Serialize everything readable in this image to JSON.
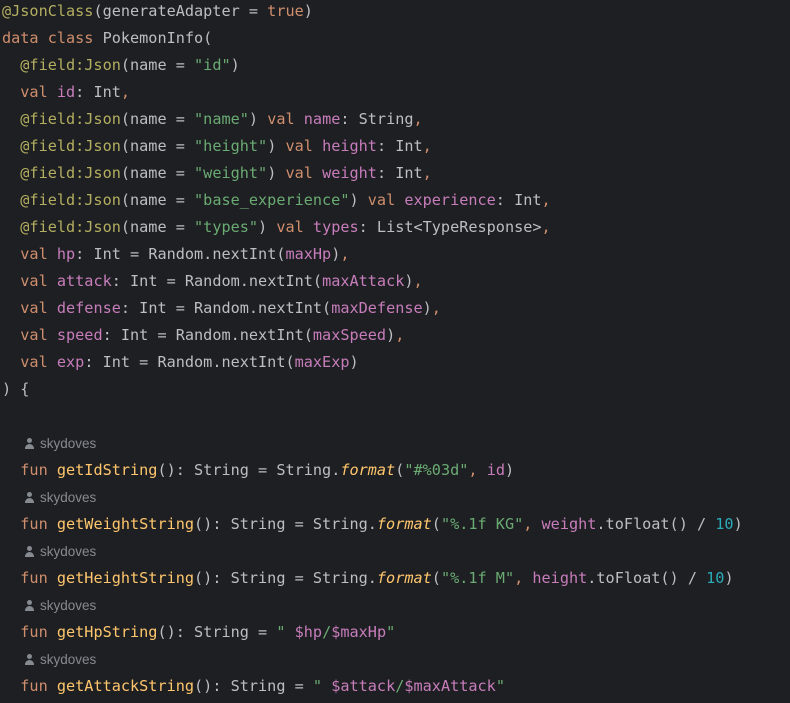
{
  "editor": {
    "language": "kotlin",
    "colors": {
      "background": "#1e1f22",
      "text": "#bcbec4",
      "keyword": "#cf8e6d",
      "annotation": "#b3ae60",
      "property": "#c77dbb",
      "string": "#6aab73",
      "number": "#2aacb8",
      "function_declaration": "#ffc66d",
      "hint": "#868a91"
    },
    "lines": [
      {
        "type": "code",
        "tokens": [
          {
            "t": "@JsonClass",
            "c": "ann"
          },
          {
            "t": "(generateAdapter = ",
            "c": "plain"
          },
          {
            "t": "true",
            "c": "kw"
          },
          {
            "t": ")",
            "c": "plain"
          }
        ]
      },
      {
        "type": "code",
        "tokens": [
          {
            "t": "data class ",
            "c": "kw"
          },
          {
            "t": "PokemonInfo(",
            "c": "plain"
          }
        ]
      },
      {
        "type": "code",
        "tokens": [
          {
            "t": "  @field:Json",
            "c": "ann"
          },
          {
            "t": "(name = ",
            "c": "plain"
          },
          {
            "t": "\"id\"",
            "c": "str"
          },
          {
            "t": ")",
            "c": "plain"
          }
        ]
      },
      {
        "type": "code",
        "tokens": [
          {
            "t": "  val ",
            "c": "kw"
          },
          {
            "t": "id",
            "c": "prop"
          },
          {
            "t": ": Int",
            "c": "plain"
          },
          {
            "t": ",",
            "c": "kw"
          }
        ]
      },
      {
        "type": "code",
        "tokens": [
          {
            "t": "  @field:Json",
            "c": "ann"
          },
          {
            "t": "(name = ",
            "c": "plain"
          },
          {
            "t": "\"name\"",
            "c": "str"
          },
          {
            "t": ") ",
            "c": "plain"
          },
          {
            "t": "val ",
            "c": "kw"
          },
          {
            "t": "name",
            "c": "prop"
          },
          {
            "t": ": String",
            "c": "plain"
          },
          {
            "t": ",",
            "c": "kw"
          }
        ]
      },
      {
        "type": "code",
        "tokens": [
          {
            "t": "  @field:Json",
            "c": "ann"
          },
          {
            "t": "(name = ",
            "c": "plain"
          },
          {
            "t": "\"height\"",
            "c": "str"
          },
          {
            "t": ") ",
            "c": "plain"
          },
          {
            "t": "val ",
            "c": "kw"
          },
          {
            "t": "height",
            "c": "prop"
          },
          {
            "t": ": Int",
            "c": "plain"
          },
          {
            "t": ",",
            "c": "kw"
          }
        ]
      },
      {
        "type": "code",
        "tokens": [
          {
            "t": "  @field:Json",
            "c": "ann"
          },
          {
            "t": "(name = ",
            "c": "plain"
          },
          {
            "t": "\"weight\"",
            "c": "str"
          },
          {
            "t": ") ",
            "c": "plain"
          },
          {
            "t": "val ",
            "c": "kw"
          },
          {
            "t": "weight",
            "c": "prop"
          },
          {
            "t": ": Int",
            "c": "plain"
          },
          {
            "t": ",",
            "c": "kw"
          }
        ]
      },
      {
        "type": "code",
        "tokens": [
          {
            "t": "  @field:Json",
            "c": "ann"
          },
          {
            "t": "(name = ",
            "c": "plain"
          },
          {
            "t": "\"base_experience\"",
            "c": "str"
          },
          {
            "t": ") ",
            "c": "plain"
          },
          {
            "t": "val ",
            "c": "kw"
          },
          {
            "t": "experience",
            "c": "prop"
          },
          {
            "t": ": Int",
            "c": "plain"
          },
          {
            "t": ",",
            "c": "kw"
          }
        ]
      },
      {
        "type": "code",
        "tokens": [
          {
            "t": "  @field:Json",
            "c": "ann"
          },
          {
            "t": "(name = ",
            "c": "plain"
          },
          {
            "t": "\"types\"",
            "c": "str"
          },
          {
            "t": ") ",
            "c": "plain"
          },
          {
            "t": "val ",
            "c": "kw"
          },
          {
            "t": "types",
            "c": "prop"
          },
          {
            "t": ": List<TypeResponse>",
            "c": "plain"
          },
          {
            "t": ",",
            "c": "kw"
          }
        ]
      },
      {
        "type": "code",
        "tokens": [
          {
            "t": "  val ",
            "c": "kw"
          },
          {
            "t": "hp",
            "c": "prop"
          },
          {
            "t": ": Int = Random.nextInt(",
            "c": "plain"
          },
          {
            "t": "maxHp",
            "c": "prop"
          },
          {
            "t": ")",
            "c": "plain"
          },
          {
            "t": ",",
            "c": "kw"
          }
        ]
      },
      {
        "type": "code",
        "tokens": [
          {
            "t": "  val ",
            "c": "kw"
          },
          {
            "t": "attack",
            "c": "prop"
          },
          {
            "t": ": Int = Random.nextInt(",
            "c": "plain"
          },
          {
            "t": "maxAttack",
            "c": "prop"
          },
          {
            "t": ")",
            "c": "plain"
          },
          {
            "t": ",",
            "c": "kw"
          }
        ]
      },
      {
        "type": "code",
        "tokens": [
          {
            "t": "  val ",
            "c": "kw"
          },
          {
            "t": "defense",
            "c": "prop"
          },
          {
            "t": ": Int = Random.nextInt(",
            "c": "plain"
          },
          {
            "t": "maxDefense",
            "c": "prop"
          },
          {
            "t": ")",
            "c": "plain"
          },
          {
            "t": ",",
            "c": "kw"
          }
        ]
      },
      {
        "type": "code",
        "tokens": [
          {
            "t": "  val ",
            "c": "kw"
          },
          {
            "t": "speed",
            "c": "prop"
          },
          {
            "t": ": Int = Random.nextInt(",
            "c": "plain"
          },
          {
            "t": "maxSpeed",
            "c": "prop"
          },
          {
            "t": ")",
            "c": "plain"
          },
          {
            "t": ",",
            "c": "kw"
          }
        ]
      },
      {
        "type": "code",
        "tokens": [
          {
            "t": "  val ",
            "c": "kw"
          },
          {
            "t": "exp",
            "c": "prop"
          },
          {
            "t": ": Int = Random.nextInt(",
            "c": "plain"
          },
          {
            "t": "maxExp",
            "c": "prop"
          },
          {
            "t": ")",
            "c": "plain"
          }
        ]
      },
      {
        "type": "code",
        "tokens": [
          {
            "t": ") {",
            "c": "plain"
          }
        ]
      },
      {
        "type": "blank",
        "tokens": []
      },
      {
        "type": "hint",
        "author": "skydoves"
      },
      {
        "type": "code",
        "tokens": [
          {
            "t": "  fun ",
            "c": "kw"
          },
          {
            "t": "getIdString",
            "c": "fndecl"
          },
          {
            "t": "(): String = String.",
            "c": "plain"
          },
          {
            "t": "format",
            "c": "static"
          },
          {
            "t": "(",
            "c": "plain"
          },
          {
            "t": "\"#%03d\"",
            "c": "str"
          },
          {
            "t": ", ",
            "c": "kw"
          },
          {
            "t": "id",
            "c": "prop"
          },
          {
            "t": ")",
            "c": "plain"
          }
        ]
      },
      {
        "type": "hint",
        "author": "skydoves"
      },
      {
        "type": "code",
        "tokens": [
          {
            "t": "  fun ",
            "c": "kw"
          },
          {
            "t": "getWeightString",
            "c": "fndecl"
          },
          {
            "t": "(): String = String.",
            "c": "plain"
          },
          {
            "t": "format",
            "c": "static"
          },
          {
            "t": "(",
            "c": "plain"
          },
          {
            "t": "\"%.1f KG\"",
            "c": "str"
          },
          {
            "t": ", ",
            "c": "kw"
          },
          {
            "t": "weight",
            "c": "prop"
          },
          {
            "t": ".toFloat() / ",
            "c": "plain"
          },
          {
            "t": "10",
            "c": "num"
          },
          {
            "t": ")",
            "c": "plain"
          }
        ]
      },
      {
        "type": "hint",
        "author": "skydoves"
      },
      {
        "type": "code",
        "tokens": [
          {
            "t": "  fun ",
            "c": "kw"
          },
          {
            "t": "getHeightString",
            "c": "fndecl"
          },
          {
            "t": "(): String = String.",
            "c": "plain"
          },
          {
            "t": "format",
            "c": "static"
          },
          {
            "t": "(",
            "c": "plain"
          },
          {
            "t": "\"%.1f M\"",
            "c": "str"
          },
          {
            "t": ", ",
            "c": "kw"
          },
          {
            "t": "height",
            "c": "prop"
          },
          {
            "t": ".toFloat() / ",
            "c": "plain"
          },
          {
            "t": "10",
            "c": "num"
          },
          {
            "t": ")",
            "c": "plain"
          }
        ]
      },
      {
        "type": "hint",
        "author": "skydoves"
      },
      {
        "type": "code",
        "tokens": [
          {
            "t": "  fun ",
            "c": "kw"
          },
          {
            "t": "getHpString",
            "c": "fndecl"
          },
          {
            "t": "(): String = ",
            "c": "plain"
          },
          {
            "t": "\" ",
            "c": "str"
          },
          {
            "t": "$hp",
            "c": "prop"
          },
          {
            "t": "/",
            "c": "str"
          },
          {
            "t": "$maxHp",
            "c": "prop"
          },
          {
            "t": "\"",
            "c": "str"
          }
        ]
      },
      {
        "type": "hint",
        "author": "skydoves"
      },
      {
        "type": "code",
        "tokens": [
          {
            "t": "  fun ",
            "c": "kw"
          },
          {
            "t": "getAttackString",
            "c": "fndecl"
          },
          {
            "t": "(): String = ",
            "c": "plain"
          },
          {
            "t": "\" ",
            "c": "str"
          },
          {
            "t": "$attack",
            "c": "prop"
          },
          {
            "t": "/",
            "c": "str"
          },
          {
            "t": "$maxAttack",
            "c": "prop"
          },
          {
            "t": "\"",
            "c": "str"
          }
        ]
      }
    ]
  }
}
